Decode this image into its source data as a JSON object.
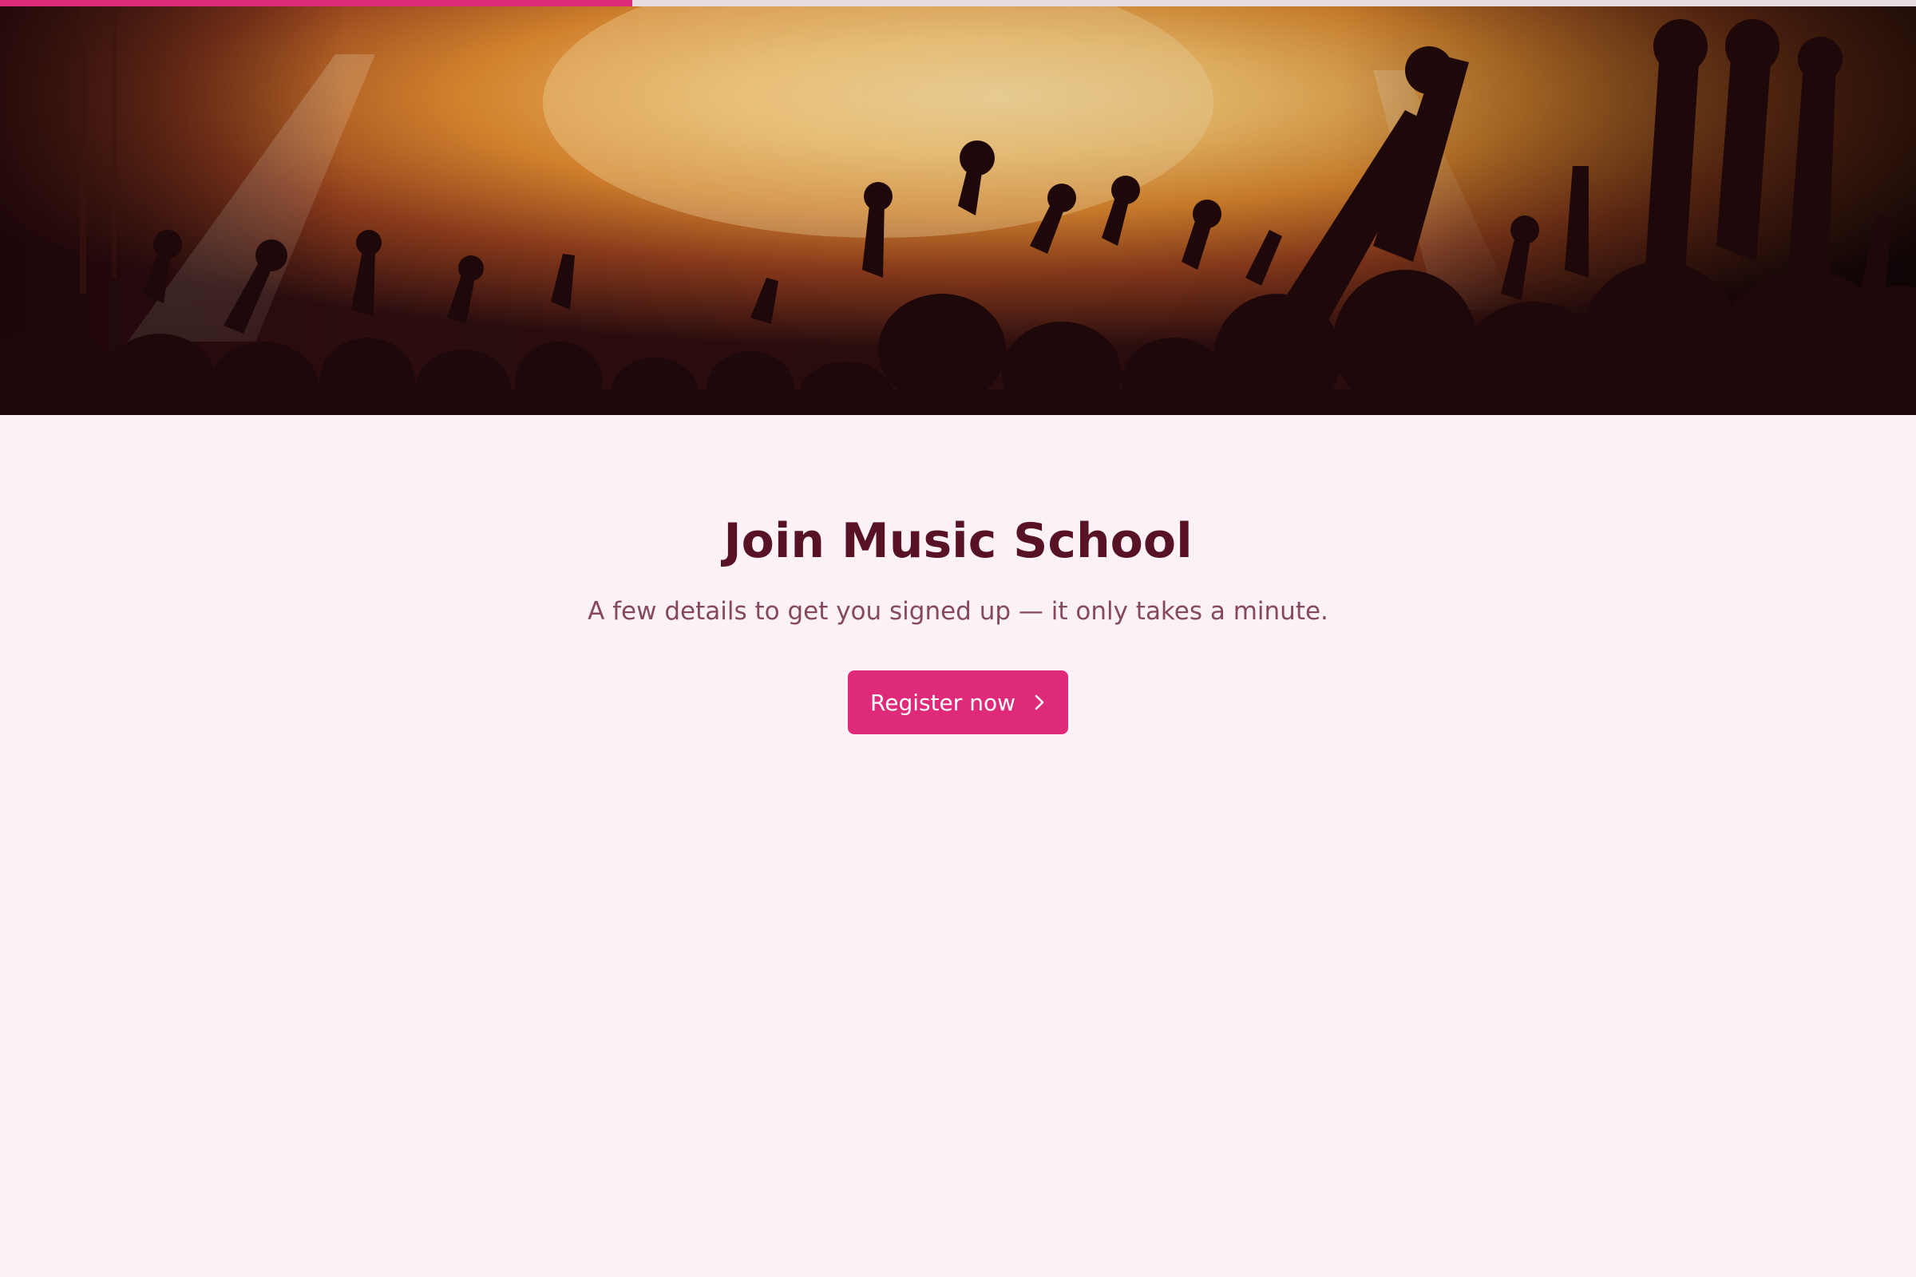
{
  "progress": {
    "fraction": 0.33,
    "color": "#df2a79"
  },
  "hero": {
    "image": "concert-crowd-hands-raised"
  },
  "main": {
    "title": "Join Music School",
    "subtitle": "A few details to get you signed up — it only takes a minute.",
    "cta_label": "Register now",
    "cta_icon": "chevron-right-icon"
  },
  "colors": {
    "accent": "#df2a79",
    "background": "#fcf1f6",
    "title": "#571225",
    "subtitle": "#86485f"
  }
}
